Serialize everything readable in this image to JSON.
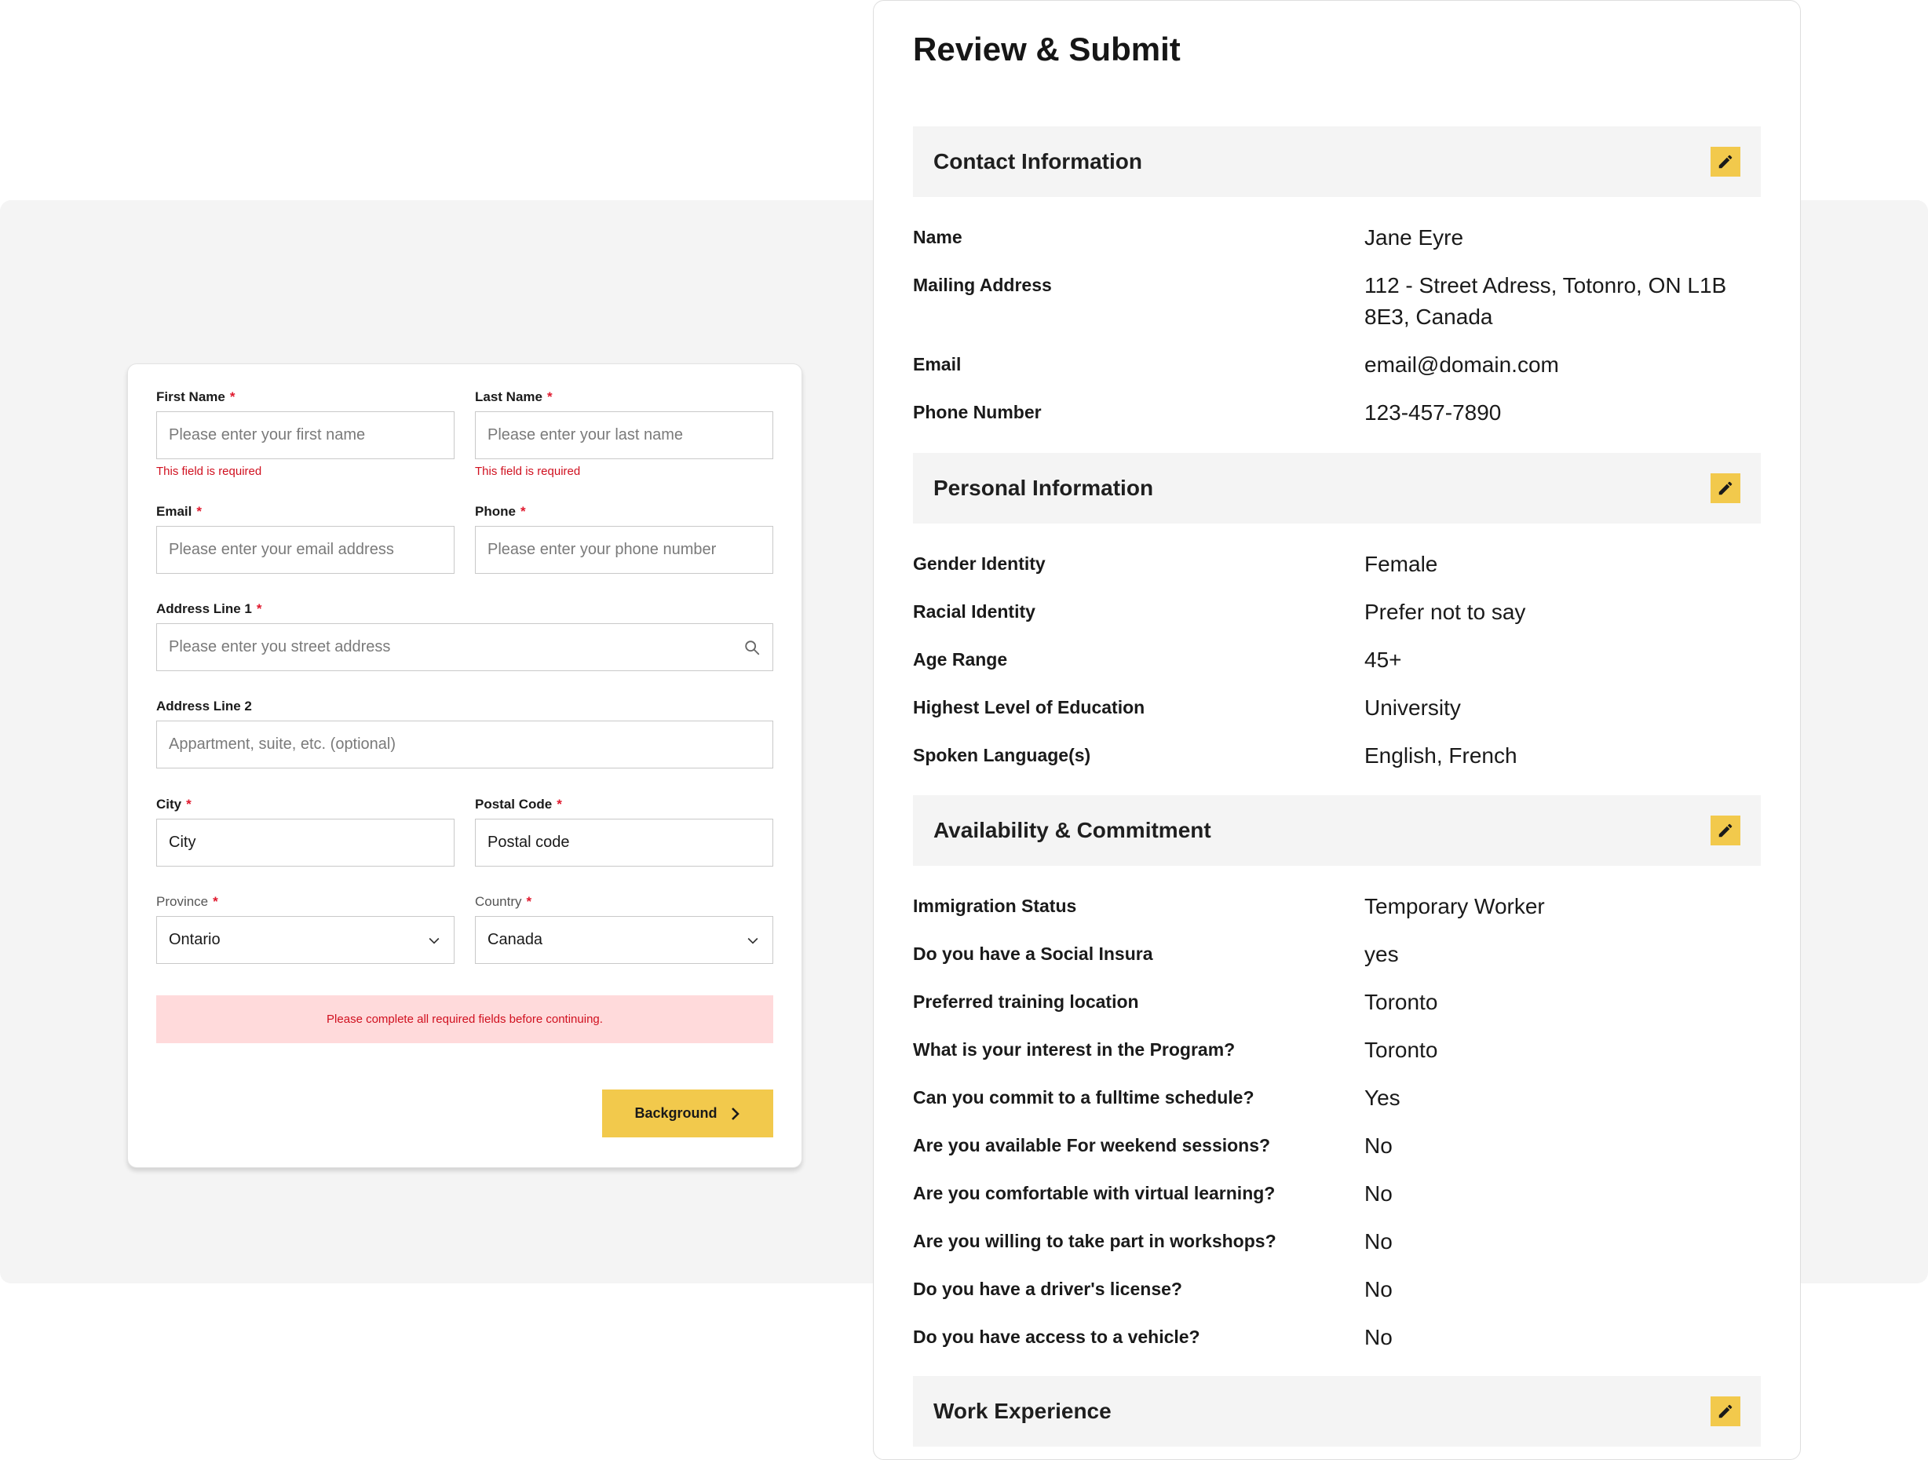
{
  "form": {
    "first_name": {
      "label": "First Name",
      "req": "*",
      "placeholder": "Please enter your first name",
      "error": "This field is required"
    },
    "last_name": {
      "label": "Last Name",
      "req": "*",
      "placeholder": "Please enter your last name",
      "error": "This field is required"
    },
    "email": {
      "label": "Email",
      "req": "*",
      "placeholder": "Please enter your email address"
    },
    "phone": {
      "label": "Phone",
      "req": "*",
      "placeholder": "Please enter your phone number"
    },
    "address1": {
      "label": "Address Line 1",
      "req": "*",
      "placeholder": "Please enter you street address"
    },
    "address2": {
      "label": "Address Line 2",
      "placeholder": "Appartment, suite, etc. (optional)"
    },
    "city": {
      "label": "City",
      "req": "*",
      "value": "City"
    },
    "postal": {
      "label": "Postal Code",
      "req": "*",
      "value": "Postal code"
    },
    "province": {
      "label": "Province",
      "req": "*",
      "value": "Ontario"
    },
    "country": {
      "label": "Country",
      "req": "*",
      "value": "Canada"
    },
    "alert": "Please complete all required fields before continuing.",
    "next_button": "Background"
  },
  "review": {
    "title": "Review & Submit",
    "sections": [
      {
        "title": "Contact Information",
        "rows": [
          {
            "k": "Name",
            "v": "Jane Eyre"
          },
          {
            "k": "Mailing Address",
            "v": "112 - Street Adress, Totonro, ON L1B 8E3, Canada"
          },
          {
            "k": "Email",
            "v": "email@domain.com"
          },
          {
            "k": "Phone Number",
            "v": "123-457-7890"
          }
        ]
      },
      {
        "title": "Personal Information",
        "rows": [
          {
            "k": "Gender Identity",
            "v": "Female"
          },
          {
            "k": "Racial Identity",
            "v": "Prefer not to say"
          },
          {
            "k": "Age Range",
            "v": "45+"
          },
          {
            "k": "Highest Level of Education",
            "v": "University"
          },
          {
            "k": "Spoken Language(s)",
            "v": "English, French"
          }
        ]
      },
      {
        "title": "Availability & Commitment",
        "rows": [
          {
            "k": "Immigration Status",
            "v": "Temporary Worker"
          },
          {
            "k": "Do you have a Social Insura",
            "v": "yes"
          },
          {
            "k": "Preferred training location",
            "v": "Toronto"
          },
          {
            "k": "What is your interest in the Program?",
            "v": "Toronto"
          },
          {
            "k": "Can you commit to a fulltime schedule?",
            "v": "Yes"
          },
          {
            "k": "Are you available For weekend sessions?",
            "v": "No"
          },
          {
            "k": "Are you comfortable with virtual learning?",
            "v": "No"
          },
          {
            "k": "Are you willing to take part in workshops?",
            "v": "No"
          },
          {
            "k": "Do you have a driver's license?",
            "v": "No"
          },
          {
            "k": "Do you have access to a vehicle?",
            "v": "No"
          }
        ]
      },
      {
        "title": "Work Experience",
        "rows": []
      }
    ]
  },
  "icons": {
    "search": "search-icon",
    "chevron": "chevron-down-icon",
    "edit": "pencil-icon",
    "next": "chevron-right-icon"
  },
  "colors": {
    "accent": "#f2c94c",
    "error": "#d0101f",
    "error_bg": "#ffdadb",
    "section_bg": "#f4f4f4"
  }
}
